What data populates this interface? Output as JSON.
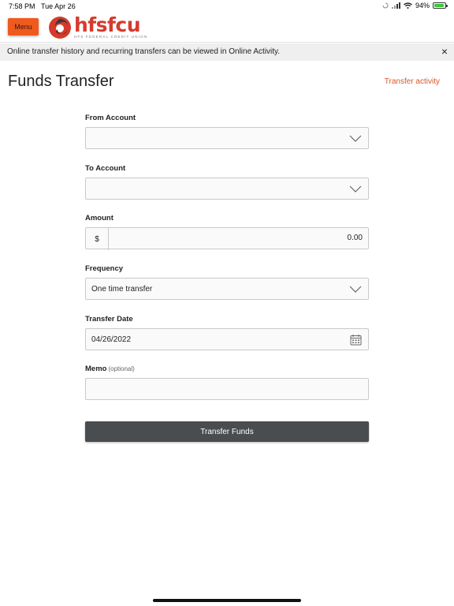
{
  "status_bar": {
    "time": "7:58 PM",
    "date": "Tue Apr 26",
    "battery": "94%"
  },
  "header": {
    "menu_label": "Menu",
    "logo_text": "hfsfcu",
    "logo_subtext": "HFS FEDERAL CREDIT UNION",
    "brand_color": "#f05a1e"
  },
  "banner": {
    "message": "Online transfer history and recurring transfers can be viewed in Online Activity.",
    "close_label": "×"
  },
  "page": {
    "title": "Funds Transfer",
    "activity_link": "Transfer activity"
  },
  "form": {
    "from_account": {
      "label": "From Account",
      "value": ""
    },
    "to_account": {
      "label": "To Account",
      "value": ""
    },
    "amount": {
      "label": "Amount",
      "currency": "$",
      "value": "0.00"
    },
    "frequency": {
      "label": "Frequency",
      "value": "One time transfer"
    },
    "transfer_date": {
      "label": "Transfer Date",
      "value": "04/26/2022"
    },
    "memo": {
      "label": "Memo",
      "optional": "(optional)",
      "value": ""
    },
    "submit_label": "Transfer Funds"
  }
}
